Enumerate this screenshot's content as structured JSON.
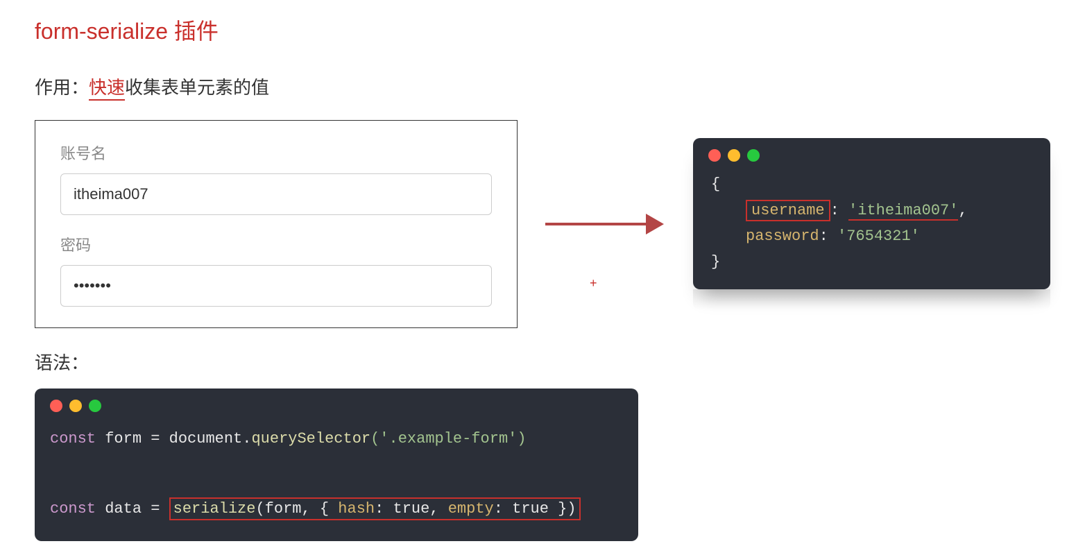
{
  "title": "form-serialize 插件",
  "desc_prefix": "作用：",
  "desc_highlight": "快速",
  "desc_suffix": "收集表单元素的值",
  "form": {
    "username_label": "账号名",
    "username_value": "itheima007",
    "password_label": "密码",
    "password_value": "•••••••"
  },
  "plus": "+",
  "result": {
    "open": "{",
    "username_key": "username",
    "username_val": "'itheima007'",
    "password_key": "password",
    "password_val": "'7654321'",
    "close": "}"
  },
  "syntax_label": "语法：",
  "code": {
    "l1_kw": "const",
    "l1_var": " form = ",
    "l1_obj": "document",
    "l1_dot": ".",
    "l1_fn": "querySelector",
    "l1_args": "('.example-form')",
    "l2_kw": "const",
    "l2_var": " data = ",
    "l2_fn": "serialize",
    "l2_args_open": "(form, { ",
    "l2_hash": "hash",
    "l2_sep1": ": true, ",
    "l2_empty": "empty",
    "l2_sep2": ": true })"
  }
}
